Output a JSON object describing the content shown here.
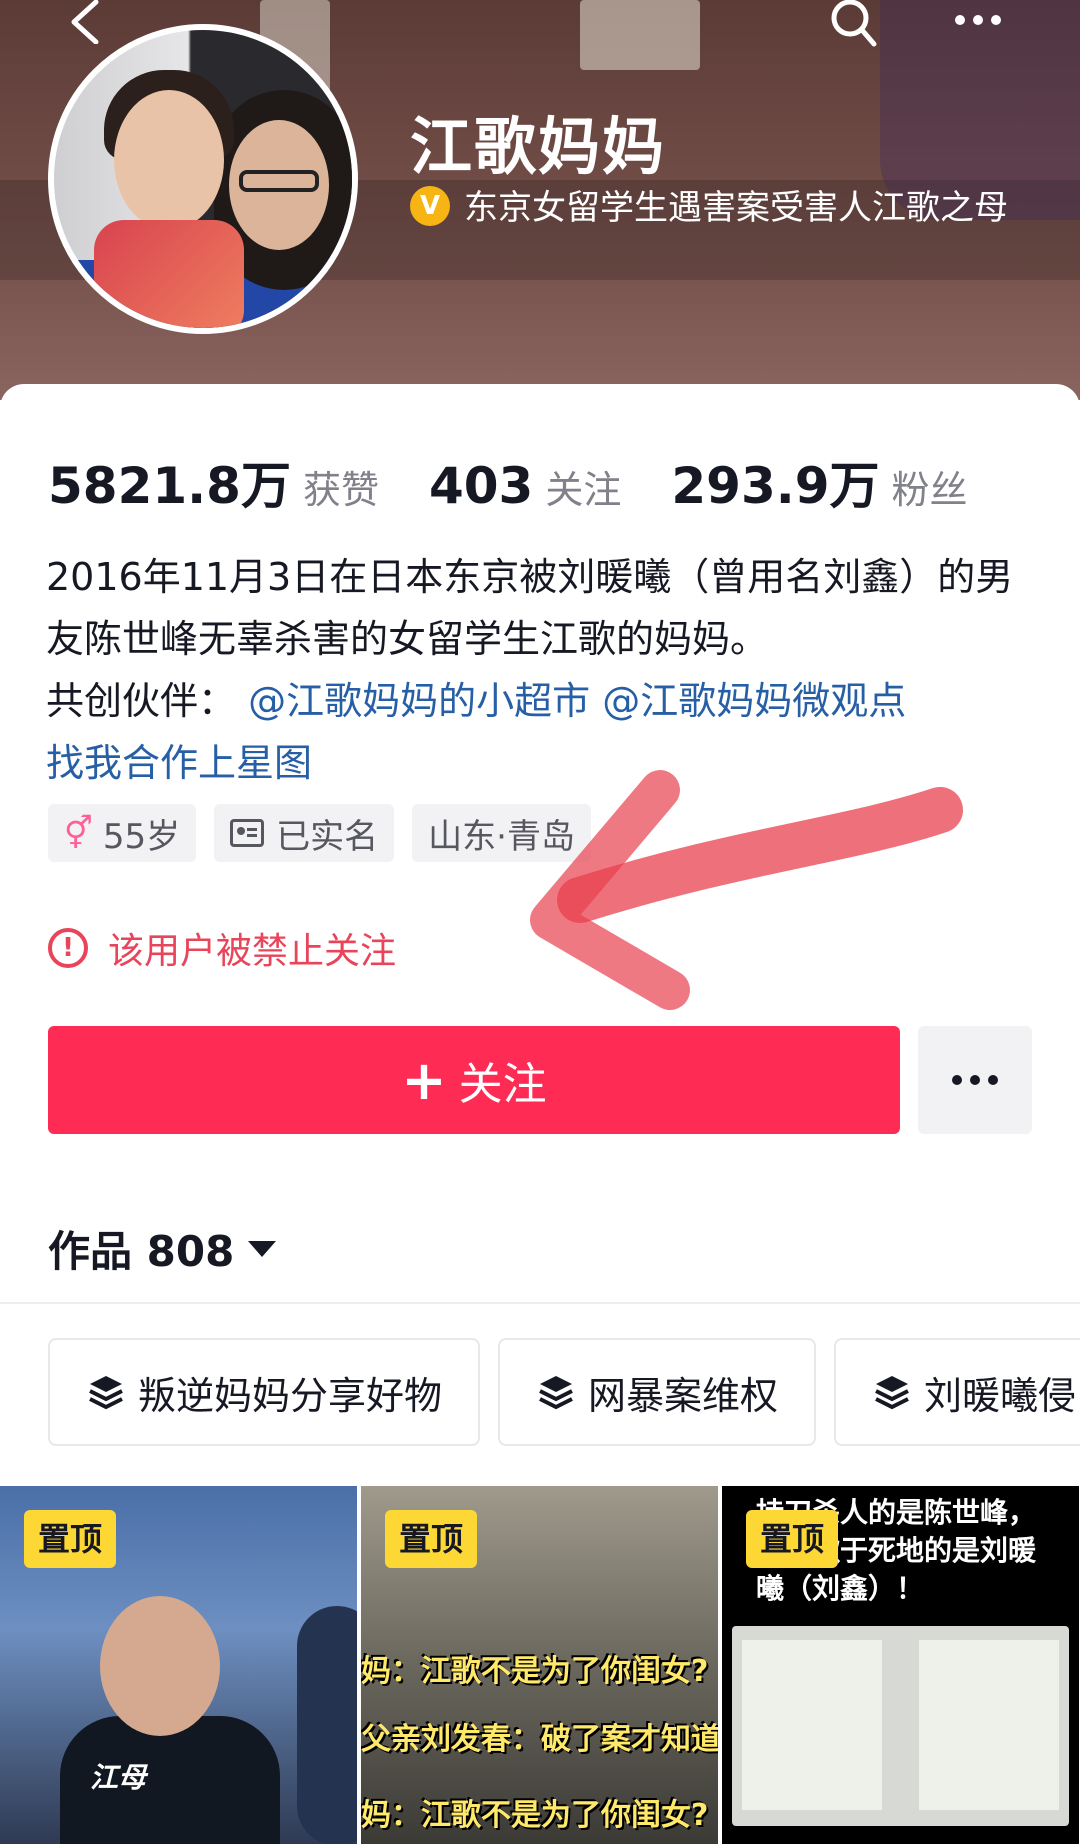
{
  "header": {
    "username": "江歌妈妈",
    "verify_mark": "V",
    "verify_text": "东京女留学生遇害案受害人江歌之母"
  },
  "stats": [
    {
      "value": "5821.8万",
      "label": "获赞"
    },
    {
      "value": "403",
      "label": "关注"
    },
    {
      "value": "293.9万",
      "label": "粉丝"
    }
  ],
  "bio": {
    "line1": "2016年11月3日在日本东京被刘暖曦（曾用名刘鑫）的男友陈世峰无辜杀害的女留学生江歌的妈妈。",
    "partner_prefix": "共创伙伴：",
    "partner_link1": "@江歌妈妈的小超市",
    "partner_link2": "@江歌妈妈微观点",
    "star_link": "找我合作上星图"
  },
  "tags": {
    "gender_symbol": "⚥",
    "age": "55岁",
    "verified_name": "已实名",
    "location": "山东·青岛"
  },
  "ban_notice": {
    "icon": "!",
    "text": "该用户被禁止关注"
  },
  "actions": {
    "follow_plus": "+",
    "follow_label": "关注"
  },
  "works": {
    "label": "作品 808"
  },
  "collections": [
    {
      "label": "叛逆妈妈分享好物"
    },
    {
      "label": "网暴案维权"
    },
    {
      "label": "刘暖曦侵"
    }
  ],
  "videos": [
    {
      "badge": "置顶",
      "caption": "江母"
    },
    {
      "badge": "置顶",
      "line1": "妈：江歌不是为了你闺女?",
      "line2": "父亲刘发春：破了案才知道",
      "line3": "妈：江歌不是为了你闺女?"
    },
    {
      "badge": "置顶",
      "top_text": "持刀杀人的是陈世峰，置江歌于死地的是刘暖曦（刘鑫）！"
    }
  ],
  "colors": {
    "accent": "#fe2c55",
    "link": "#275fa6",
    "warning": "#e8445a",
    "badge": "#fdd835"
  }
}
